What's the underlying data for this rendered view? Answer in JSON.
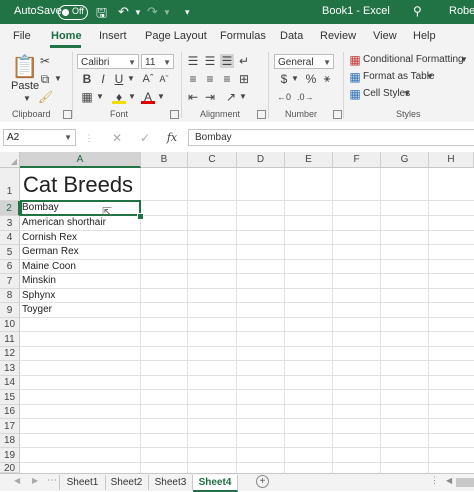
{
  "titlebar": {
    "autosave_label": "AutoSave",
    "autosave_state": "Off",
    "document_title": "Book1 - Excel",
    "user_name": "Rober"
  },
  "tabs": [
    "File",
    "Home",
    "Insert",
    "Page Layout",
    "Formulas",
    "Data",
    "Review",
    "View",
    "Help"
  ],
  "ribbon": {
    "clipboard": {
      "paste_label": "Paste",
      "group_label": "Clipboard"
    },
    "font": {
      "font_name": "Calibri",
      "font_size": "11",
      "group_label": "Font",
      "bold": "B",
      "italic": "I",
      "underline": "U"
    },
    "alignment": {
      "group_label": "Alignment"
    },
    "number": {
      "format": "General",
      "group_label": "Number",
      "currency": "$",
      "percent": "%"
    },
    "styles": {
      "conditional_formatting": "Conditional Formatting",
      "format_as_table": "Format as Table",
      "cell_styles": "Cell Styles",
      "group_label": "Styles"
    },
    "accent_color": "#217346"
  },
  "formula_bar": {
    "name_box": "A2",
    "fx_label": "fx",
    "content": "Bombay"
  },
  "grid": {
    "columns": [
      "A",
      "B",
      "C",
      "D",
      "E",
      "F",
      "G",
      "H"
    ],
    "rows": [
      "1",
      "2",
      "3",
      "4",
      "5",
      "6",
      "7",
      "8",
      "9",
      "10",
      "11",
      "12",
      "13",
      "14",
      "15",
      "16",
      "17",
      "18",
      "19",
      "20"
    ],
    "heading": "Cat Breeds",
    "cells": [
      "Bombay",
      "American shorthair",
      "Cornish Rex",
      "German Rex",
      "Maine Coon",
      "Minskin",
      "Sphynx",
      "Toyger"
    ]
  },
  "sheets": {
    "tabs": [
      "Sheet1",
      "Sheet2",
      "Sheet3",
      "Sheet4"
    ],
    "active": "Sheet4",
    "add_label": "+"
  }
}
